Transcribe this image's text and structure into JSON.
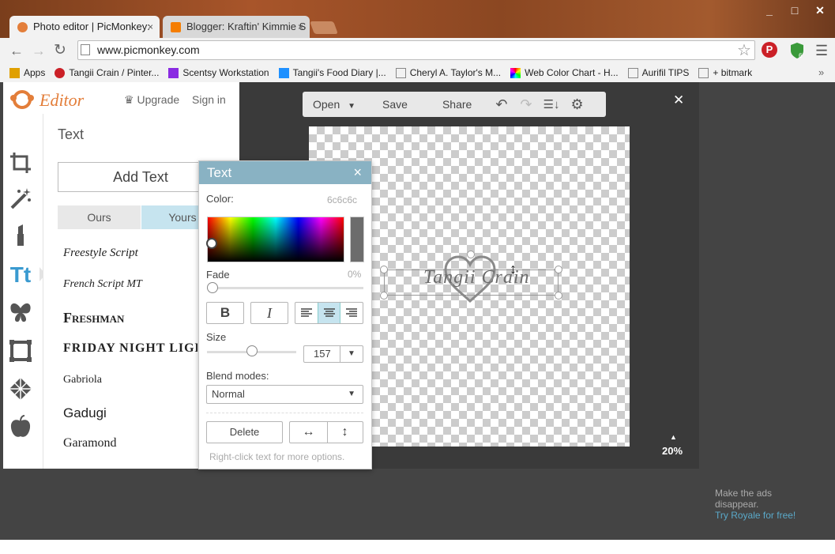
{
  "browser": {
    "window_controls": [
      "_",
      "□",
      "✕"
    ],
    "tabs": [
      {
        "title": "Photo editor | PicMonkey:",
        "close": "×"
      },
      {
        "title": "Blogger: Kraftin' Kimmie S",
        "close": "×"
      }
    ],
    "url": "www.picmonkey.com",
    "bookmarks": [
      {
        "label": "Apps",
        "color": "#e0a000"
      },
      {
        "label": "Tangii Crain / Pinter...",
        "color": "#cb2027"
      },
      {
        "label": "Scentsy Workstation",
        "color": "#8a2be2"
      },
      {
        "label": "Tangii's Food Diary |...",
        "color": "#1e90ff"
      },
      {
        "label": "Cheryl A. Taylor's M...",
        "color": "#888888"
      },
      {
        "label": "Web Color Chart - H...",
        "color": "#e040fb"
      },
      {
        "label": "Aurifil TIPS",
        "color": "#888888"
      },
      {
        "label": "+ bitmark",
        "color": "#888888"
      }
    ],
    "more": "»"
  },
  "app": {
    "logo": "Editor",
    "upgrade": "Upgrade",
    "signin": "Sign in",
    "panel_title": "Text",
    "add_text": "Add Text",
    "tabs": [
      "Ours",
      "Yours"
    ],
    "fonts": [
      "Freestyle Script",
      "French Script MT",
      "Freshman",
      "FRIDAY NIGHT LIGHTS",
      "Gabriola",
      "Gadugi",
      "Garamond"
    ],
    "toolbar": {
      "open": "Open",
      "save": "Save",
      "share": "Share"
    },
    "close": "✕",
    "zoom": "20%",
    "ads": {
      "line1": "Make the ads",
      "line2": "disappear.",
      "link": "Try Royale for free!"
    }
  },
  "canvas": {
    "watermark_text": "Tangii Crain"
  },
  "dialog": {
    "title": "Text",
    "close": "×",
    "color_label": "Color:",
    "color_value": "6c6c6c",
    "fade_label": "Fade",
    "fade_value": "0%",
    "fade_level": 0,
    "bold": "B",
    "italic": "I",
    "size_label": "Size",
    "size_value": "157",
    "blend_label": "Blend modes:",
    "blend_value": "Normal",
    "delete": "Delete",
    "hint": "Right-click text for more options."
  },
  "colors": {
    "dialog_header": "#89b2c3",
    "accent": "#5aa9c9",
    "yours_tab": "#c6e4ef"
  }
}
